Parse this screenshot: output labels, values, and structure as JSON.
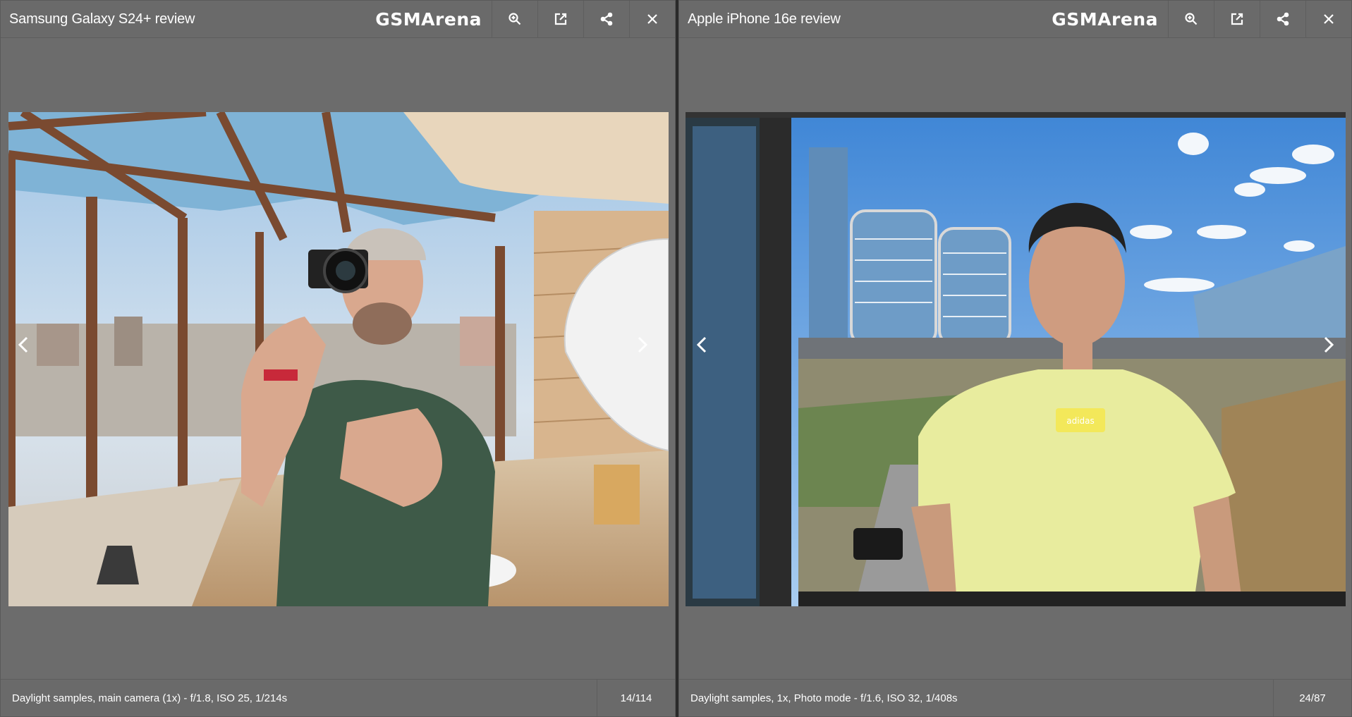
{
  "brand": "GSMArena",
  "left": {
    "title": "Samsung Galaxy S24+ review",
    "caption": "Daylight samples, main camera (1x) - f/1.8, ISO 25, 1/214s",
    "counter": "14/114"
  },
  "right": {
    "title": "Apple iPhone 16e review",
    "caption": "Daylight samples, 1x, Photo mode - f/1.6, ISO 32, 1/408s",
    "counter": "24/87",
    "shirt_logo": "adidas"
  },
  "icons": [
    "zoom-in-icon",
    "open-external-icon",
    "share-icon",
    "close-icon",
    "chevron-left-icon",
    "chevron-right-icon"
  ],
  "colors": {
    "panel": "#6c6c6c",
    "bar": "#6a6a6a",
    "text": "#ffffff"
  }
}
